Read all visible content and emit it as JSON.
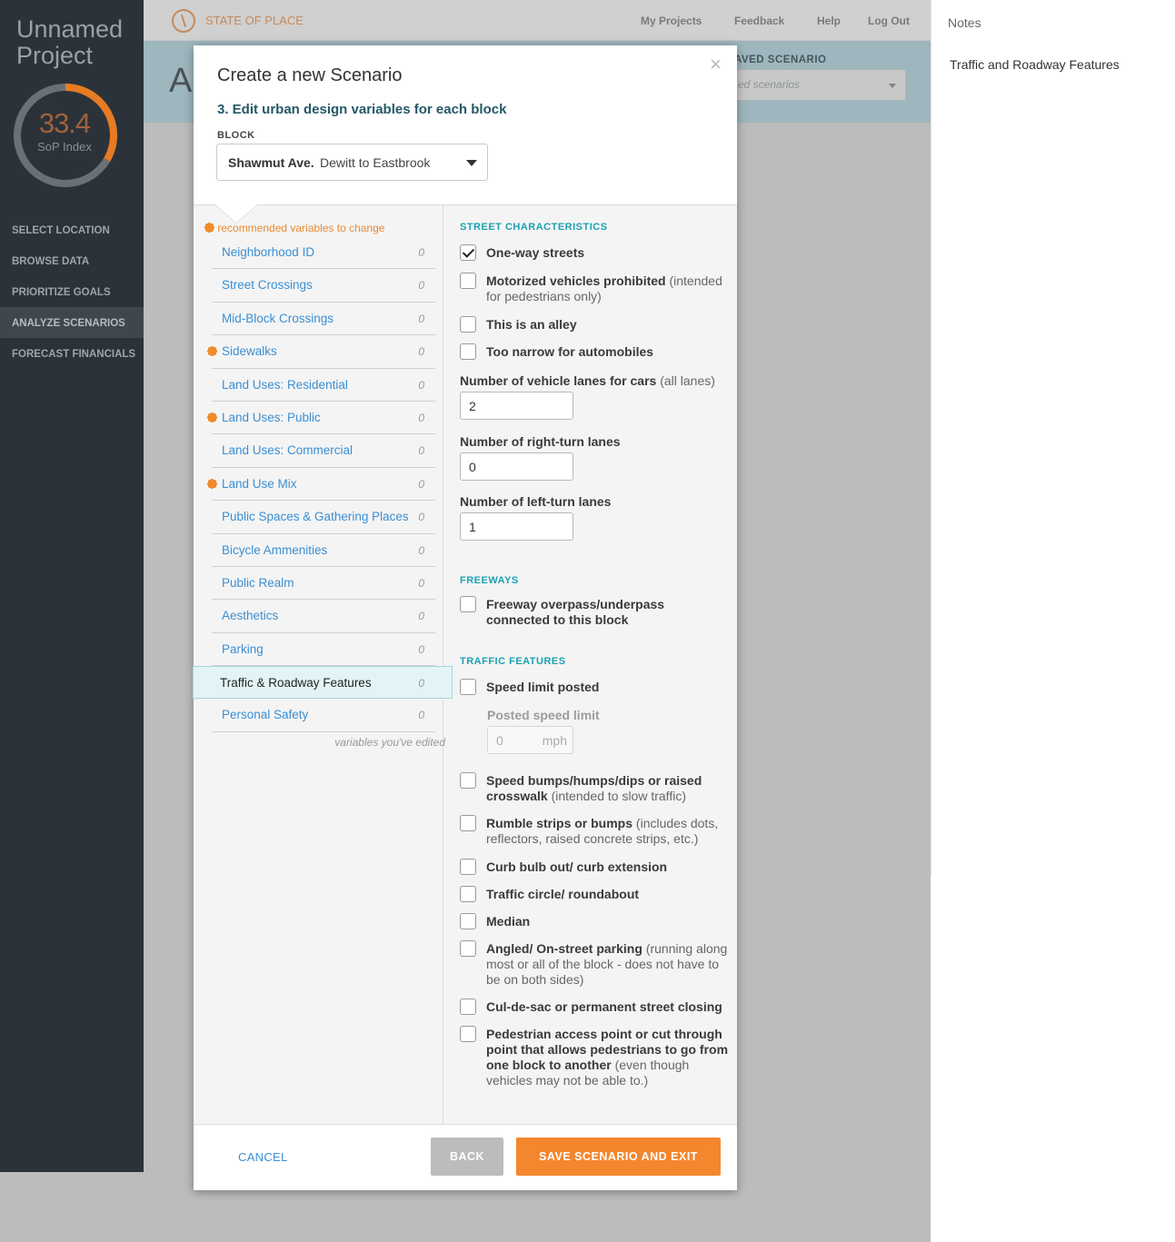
{
  "project": {
    "title_line1": "Unnamed",
    "title_line2": "Project",
    "sop_value": "33.4",
    "sop_label": "SoP Index",
    "sop_fraction": 0.334
  },
  "nav": {
    "items": [
      "SELECT LOCATION",
      "BROWSE DATA",
      "PRIORITIZE GOALS",
      "ANALYZE SCENARIOS",
      "FORECAST FINANCIALS"
    ],
    "active": "ANALYZE SCENARIOS"
  },
  "topbar": {
    "brand": "STATE OF PLACE",
    "links": [
      "My Projects",
      "Feedback",
      "Help",
      "Log Out"
    ]
  },
  "hero": {
    "title_fragment": "A",
    "saved_label": "AVED SCENARIO",
    "saved_placeholder": "ed scenarios"
  },
  "notes": {
    "title": "Notes",
    "body": "Traffic and Roadway Features"
  },
  "modal": {
    "title": "Create a new Scenario",
    "close": "×",
    "step": "3. Edit urban design variables for each block",
    "block_label": "BLOCK",
    "block_street": "Shawmut Ave.",
    "block_range": "Dewitt to Eastbrook",
    "recommended_legend": "recommended variables to change",
    "edited_legend": "variables you've edited",
    "variables": [
      {
        "name": "Neighborhood ID",
        "count": "0",
        "recommended": false
      },
      {
        "name": "Street Crossings",
        "count": "0",
        "recommended": false
      },
      {
        "name": "Mid-Block Crossings",
        "count": "0",
        "recommended": false
      },
      {
        "name": "Sidewalks",
        "count": "0",
        "recommended": true
      },
      {
        "name": "Land Uses: Residential",
        "count": "0",
        "recommended": false
      },
      {
        "name": "Land Uses: Public",
        "count": "0",
        "recommended": true
      },
      {
        "name": "Land Uses: Commercial",
        "count": "0",
        "recommended": false
      },
      {
        "name": "Land Use Mix",
        "count": "0",
        "recommended": true
      },
      {
        "name": "Public Spaces & Gathering Places",
        "count": "0",
        "recommended": false
      },
      {
        "name": "Bicycle Ammenities",
        "count": "0",
        "recommended": false
      },
      {
        "name": "Public Realm",
        "count": "0",
        "recommended": false
      },
      {
        "name": "Aesthetics",
        "count": "0",
        "recommended": false
      },
      {
        "name": "Parking",
        "count": "0",
        "recommended": false
      },
      {
        "name": "Traffic & Roadway Features",
        "count": "0",
        "recommended": false,
        "active": true
      },
      {
        "name": "Personal Safety",
        "count": "0",
        "recommended": false
      }
    ],
    "street_characteristics": {
      "heading": "STREET CHARACTERISTICS",
      "one_way": "One-way streets",
      "motorized_prohibited": "Motorized vehicles prohibited",
      "motorized_prohibited_sub": "(intended for pedestrians only)",
      "alley": "This is an alley",
      "too_narrow": "Too narrow for automobiles",
      "vehicle_lanes_label": "Number of vehicle lanes for cars",
      "vehicle_lanes_sub": "(all lanes)",
      "vehicle_lanes_value": "2",
      "right_turn_label": "Number of right-turn lanes",
      "right_turn_value": "0",
      "left_turn_label": "Number of left-turn lanes",
      "left_turn_value": "1"
    },
    "freeways": {
      "heading": "FREEWAYS",
      "overpass": "Freeway overpass/underpass connected to this block"
    },
    "traffic_features": {
      "heading": "TRAFFIC FEATURES",
      "speed_limit_posted": "Speed limit posted",
      "posted_speed_label": "Posted speed limit",
      "posted_speed_value": "0",
      "posted_speed_unit": "mph",
      "speed_bumps": "Speed bumps/humps/dips or raised crosswalk",
      "speed_bumps_sub": "(intended to slow traffic)",
      "rumble": "Rumble strips or bumps",
      "rumble_sub": "(includes dots, reflectors, raised concrete strips, etc.)",
      "curb_bulb": "Curb bulb out/ curb extension",
      "traffic_circle": "Traffic circle/ roundabout",
      "median": "Median",
      "angled_parking": "Angled/ On-street parking",
      "angled_parking_sub": "(running along most or all of the block - does not have to be on both sides)",
      "cul_de_sac": "Cul-de-sac or permanent street closing",
      "ped_access": "Pedestrian access point or cut through point that allows pedestrians to go from one block to another",
      "ped_access_sub": "(even though vehicles may not be able to.)"
    },
    "footer": {
      "cancel": "CANCEL",
      "back": "BACK",
      "save": "SAVE SCENARIO AND EXIT"
    }
  },
  "colors": {
    "accent": "#f4862e",
    "link": "#3a8fd4",
    "section_heading": "#1ba2b3",
    "sidebar": "#2b323a",
    "hero": "#9eb6be"
  }
}
